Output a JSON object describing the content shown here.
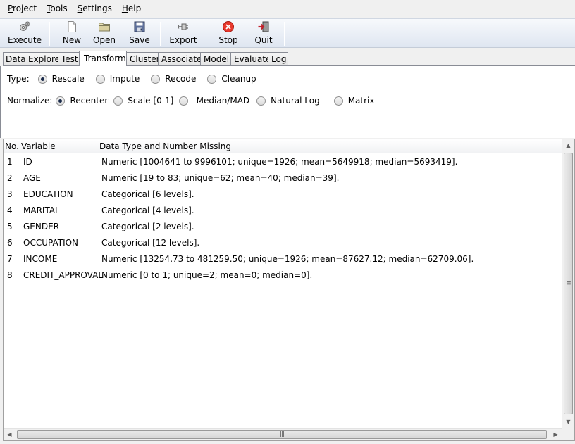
{
  "menu": [
    {
      "mnemonic": "P",
      "rest": "roject"
    },
    {
      "mnemonic": "T",
      "rest": "ools"
    },
    {
      "mnemonic": "S",
      "rest": "ettings"
    },
    {
      "mnemonic": "H",
      "rest": "elp"
    }
  ],
  "toolbar": {
    "execute": "Execute",
    "new": "New",
    "open": "Open",
    "save": "Save",
    "export": "Export",
    "stop": "Stop",
    "quit": "Quit"
  },
  "tabs": [
    "Data",
    "Explore",
    "Test",
    "Transform",
    "Cluster",
    "Associate",
    "Model",
    "Evaluate",
    "Log"
  ],
  "active_tab": "Transform",
  "type_row": {
    "label": "Type:",
    "options": [
      "Rescale",
      "Impute",
      "Recode",
      "Cleanup"
    ],
    "selected": "Rescale"
  },
  "normalize_row": {
    "label": "Normalize:",
    "options": [
      "Recenter",
      "Scale [0-1]",
      "-Median/MAD",
      "Natural Log",
      "Matrix"
    ],
    "selected": "Recenter"
  },
  "table": {
    "headers": {
      "no": "No.",
      "variable": "Variable",
      "desc": "Data Type and Number Missing"
    },
    "rows": [
      {
        "no": "1",
        "variable": "ID",
        "desc": "Numeric [1004641 to 9996101; unique=1926; mean=5649918; median=5693419]."
      },
      {
        "no": "2",
        "variable": "AGE",
        "desc": "Numeric [19 to 83; unique=62; mean=40; median=39]."
      },
      {
        "no": "3",
        "variable": "EDUCATION",
        "desc": "Categorical [6 levels]."
      },
      {
        "no": "4",
        "variable": "MARITAL",
        "desc": "Categorical [4 levels]."
      },
      {
        "no": "5",
        "variable": "GENDER",
        "desc": "Categorical [2 levels]."
      },
      {
        "no": "6",
        "variable": "OCCUPATION",
        "desc": "Categorical [12 levels]."
      },
      {
        "no": "7",
        "variable": "INCOME",
        "desc": "Numeric [13254.73 to 481259.50; unique=1926; mean=87627.12; median=62709.06]."
      },
      {
        "no": "8",
        "variable": "CREDIT_APPROVAL",
        "desc": "Numeric [0 to 1; unique=2; mean=0; median=0]."
      }
    ]
  },
  "colors": {
    "stop": "#e8382c",
    "quit": "#c0202a"
  }
}
